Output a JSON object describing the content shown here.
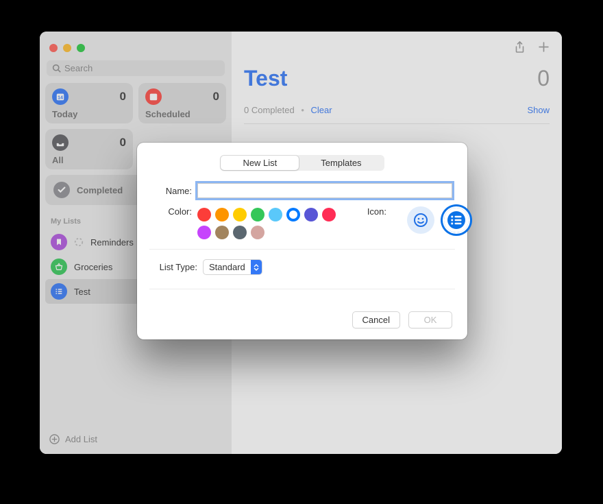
{
  "sidebar": {
    "traffic_colors": [
      "#ff5f57",
      "#febc2e",
      "#28c840"
    ],
    "search_placeholder": "Search",
    "cards": [
      {
        "label": "Today",
        "count": "0",
        "bg": "#3478f6",
        "icon": "calendar"
      },
      {
        "label": "Scheduled",
        "count": "0",
        "bg": "#fc4741",
        "icon": "calendar"
      },
      {
        "label": "All",
        "count": "0",
        "bg": "#5b5b5f",
        "icon": "tray"
      },
      {
        "label": "Completed",
        "count": "",
        "bg": "#8e8e93",
        "icon": "check",
        "full": true
      }
    ],
    "section_label": "My Lists",
    "lists": [
      {
        "name": "Reminders",
        "bg": "#af52de",
        "icon": "bookmark",
        "spinner": true
      },
      {
        "name": "Groceries",
        "bg": "#34c759",
        "icon": "basket"
      },
      {
        "name": "Test",
        "bg": "#3478f6",
        "icon": "lines",
        "selected": true
      }
    ],
    "add_list": "Add List"
  },
  "main": {
    "title": "Test",
    "count": "0",
    "completed_text": "0 Completed",
    "clear": "Clear",
    "show": "Show"
  },
  "dialog": {
    "tabs": [
      "New List",
      "Templates"
    ],
    "active_tab": 0,
    "name_label": "Name:",
    "name_value": "",
    "color_label": "Color:",
    "colors": [
      "#fc3d39",
      "#fd9500",
      "#ffcc00",
      "#34c759",
      "#5ac8fa",
      "#007aff",
      "#5856d6",
      "#ff2d55",
      "#c644fc",
      "#a2845e",
      "#5b6770",
      "#d4a5a0"
    ],
    "selected_color_index": 5,
    "icon_label": "Icon:",
    "list_type_label": "List Type:",
    "list_type_value": "Standard",
    "cancel": "Cancel",
    "ok": "OK"
  }
}
